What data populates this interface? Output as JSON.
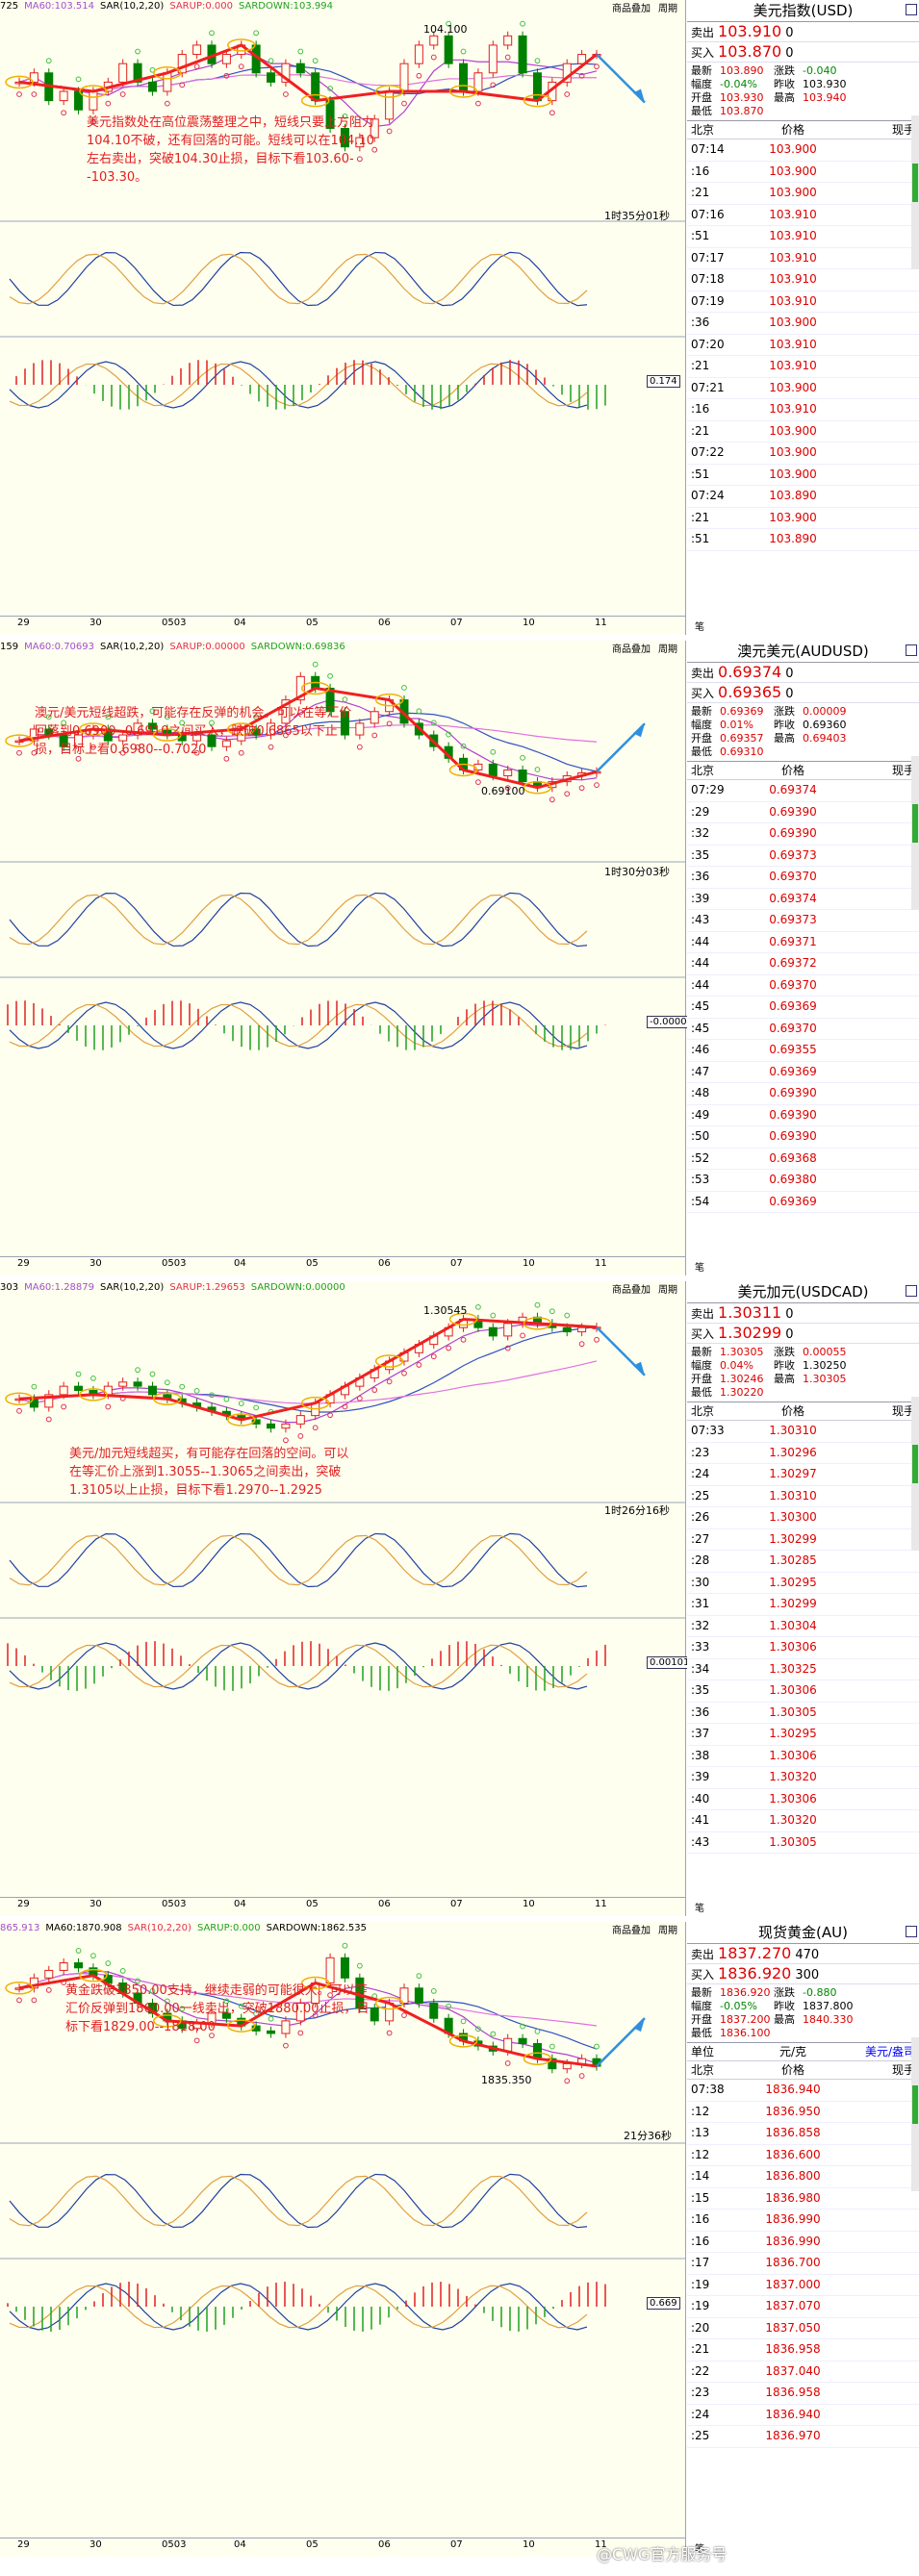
{
  "chart_data": [
    {
      "type": "candlestick",
      "symbol_cn": "美元指数(USD)",
      "indicators": [
        "MA60:103.514",
        "SAR(10,2,20)",
        "SARUP:0.000",
        "SARDOWN:103.994"
      ],
      "header_left": "725",
      "peak_label": "104.100",
      "x_ticks": [
        "29",
        "30",
        "0503",
        "04",
        "05",
        "06",
        "07",
        "10",
        "11"
      ],
      "timer": "1时35分01秒",
      "macd_value": "0.174",
      "close": [
        103.6,
        103.7,
        103.4,
        103.5,
        103.3,
        103.5,
        103.6,
        103.8,
        103.6,
        103.5,
        103.7,
        103.9,
        104.0,
        103.8,
        103.9,
        104.0,
        103.7,
        103.6,
        103.8,
        103.7,
        103.4,
        103.1,
        102.9,
        103.0,
        103.2,
        103.5,
        103.8,
        104.0,
        104.1,
        103.8,
        103.5,
        103.7,
        104.0,
        104.1,
        103.7,
        103.4,
        103.6,
        103.8,
        103.9,
        103.9
      ],
      "annotation": "美元指数处在高位震荡整理之中，短线只要上方阻力104.10不破，还有回落的可能。短线可以在104.10左右卖出，突破104.30止损，目标下看103.60--103.30。"
    },
    {
      "type": "candlestick",
      "symbol_cn": "澳元美元(AUDUSD)",
      "indicators": [
        "MA60:0.70693",
        "SAR(10,2,20)",
        "SARUP:0.00000",
        "SARDOWN:0.69836"
      ],
      "header_left": "159",
      "low_label": "0.69100",
      "x_ticks": [
        "29",
        "30",
        "0503",
        "04",
        "05",
        "06",
        "07",
        "10",
        "11"
      ],
      "timer": "1时30分03秒",
      "macd_value": "-0.00002",
      "close": [
        0.699,
        0.701,
        0.7,
        0.698,
        0.7,
        0.701,
        0.699,
        0.7,
        0.702,
        0.701,
        0.7,
        0.699,
        0.7,
        0.698,
        0.699,
        0.701,
        0.7,
        0.702,
        0.706,
        0.71,
        0.708,
        0.704,
        0.7,
        0.702,
        0.704,
        0.706,
        0.702,
        0.7,
        0.698,
        0.696,
        0.694,
        0.695,
        0.693,
        0.694,
        0.692,
        0.691,
        0.692,
        0.693,
        0.6935,
        0.6937
      ],
      "annotation": "澳元/美元短线超跌，可能存在反弹的机会。可以在等汇价回落到0.6900--0.6910之间买入，跌破0.6865以下止损，目标上看0.6980--0.7020"
    },
    {
      "type": "candlestick",
      "symbol_cn": "美元加元(USDCAD)",
      "indicators": [
        "MA60:1.28879",
        "SAR(10,2,20)",
        "SARUP:1.29653",
        "SARDOWN:0.00000"
      ],
      "header_left": "303",
      "peak_label": "1.30545",
      "x_ticks": [
        "29",
        "30",
        "0503",
        "04",
        "05",
        "06",
        "07",
        "10",
        "11"
      ],
      "timer": "1时26分16秒",
      "macd_value": "0.00101",
      "close": [
        1.286,
        1.284,
        1.287,
        1.289,
        1.288,
        1.287,
        1.289,
        1.29,
        1.289,
        1.287,
        1.286,
        1.285,
        1.284,
        1.283,
        1.282,
        1.281,
        1.28,
        1.279,
        1.28,
        1.282,
        1.285,
        1.287,
        1.289,
        1.291,
        1.293,
        1.295,
        1.297,
        1.299,
        1.301,
        1.303,
        1.305,
        1.303,
        1.301,
        1.304,
        1.3055,
        1.304,
        1.303,
        1.302,
        1.303,
        1.3031
      ],
      "annotation": "美元/加元短线超买，有可能存在回落的空间。可以在等汇价上涨到1.3055--1.3065之间卖出，突破1.3105以上止损，目标下看1.2970--1.2925"
    },
    {
      "type": "candlestick",
      "symbol_cn": "现货黄金(AU)",
      "indicators": [
        "865.913",
        "MA60:1870.908",
        "SAR(10,2,20)",
        "SARUP:0.000",
        "SARDOWN:1862.535"
      ],
      "low_label": "1835.350",
      "x_ticks": [
        "29",
        "30",
        "0503",
        "04",
        "05",
        "06",
        "07",
        "10",
        "11"
      ],
      "timer": "21分36秒",
      "macd_value": "0.669",
      "close": [
        1868,
        1872,
        1875,
        1878,
        1876,
        1873,
        1870,
        1866,
        1862,
        1858,
        1855,
        1852,
        1854,
        1858,
        1856,
        1853,
        1851,
        1850,
        1855,
        1862,
        1870,
        1880,
        1872,
        1860,
        1855,
        1862,
        1868,
        1862,
        1856,
        1850,
        1847,
        1845,
        1843,
        1848,
        1846,
        1840,
        1836,
        1838,
        1840,
        1837
      ],
      "annotation": "黄金跌破1850.00支持，继续走弱的可能很大。可以等汇价反弹到1860.00一线卖出，突破1880.00止损，目标下看1829.00--1818.00"
    }
  ],
  "common": {
    "btn_add": "商品叠加",
    "btn_period": "周期",
    "bottom_button": "笔"
  },
  "quotes": [
    {
      "title": "美元指数(USD)",
      "sell_label": "卖出",
      "sell": "103.910",
      "sell_vol": "0",
      "buy_label": "买入",
      "buy": "103.870",
      "buy_vol": "0",
      "stats": [
        [
          "最新",
          "103.890",
          "涨跌",
          "-0.040"
        ],
        [
          "幅度",
          "-0.04%",
          "昨收",
          "103.930"
        ],
        [
          "开盘",
          "103.930",
          "最高",
          "103.940"
        ],
        [
          "最低",
          "103.870",
          "",
          ""
        ]
      ],
      "hdr": [
        "北京",
        "价格",
        "现手"
      ],
      "ticks": [
        [
          "07:14",
          "103.900"
        ],
        [
          ":16",
          "103.900"
        ],
        [
          ":21",
          "103.900"
        ],
        [
          "07:16",
          "103.910"
        ],
        [
          ":51",
          "103.910"
        ],
        [
          "07:17",
          "103.910"
        ],
        [
          "07:18",
          "103.910"
        ],
        [
          "07:19",
          "103.910"
        ],
        [
          ":36",
          "103.900"
        ],
        [
          "07:20",
          "103.910"
        ],
        [
          ":21",
          "103.910"
        ],
        [
          "07:21",
          "103.900"
        ],
        [
          ":16",
          "103.910"
        ],
        [
          ":21",
          "103.900"
        ],
        [
          "07:22",
          "103.900"
        ],
        [
          ":51",
          "103.900"
        ],
        [
          "07:24",
          "103.890"
        ],
        [
          ":21",
          "103.900"
        ],
        [
          ":51",
          "103.890"
        ]
      ]
    },
    {
      "title": "澳元美元(AUDUSD)",
      "sell_label": "卖出",
      "sell": "0.69374",
      "sell_vol": "0",
      "buy_label": "买入",
      "buy": "0.69365",
      "buy_vol": "0",
      "stats": [
        [
          "最新",
          "0.69369",
          "涨跌",
          "0.00009"
        ],
        [
          "幅度",
          "0.01%",
          "昨收",
          "0.69360"
        ],
        [
          "开盘",
          "0.69357",
          "最高",
          "0.69403"
        ],
        [
          "最低",
          "0.69310",
          "",
          ""
        ]
      ],
      "hdr": [
        "北京",
        "价格",
        "现手"
      ],
      "ticks": [
        [
          "07:29",
          "0.69374"
        ],
        [
          ":29",
          "0.69390"
        ],
        [
          ":32",
          "0.69390"
        ],
        [
          ":35",
          "0.69373"
        ],
        [
          ":36",
          "0.69370"
        ],
        [
          ":39",
          "0.69374"
        ],
        [
          ":43",
          "0.69373"
        ],
        [
          ":44",
          "0.69371"
        ],
        [
          ":44",
          "0.69372"
        ],
        [
          ":44",
          "0.69370"
        ],
        [
          ":45",
          "0.69369"
        ],
        [
          ":45",
          "0.69370"
        ],
        [
          ":46",
          "0.69355"
        ],
        [
          ":47",
          "0.69369"
        ],
        [
          ":48",
          "0.69390"
        ],
        [
          ":49",
          "0.69390"
        ],
        [
          ":50",
          "0.69390"
        ],
        [
          ":52",
          "0.69368"
        ],
        [
          ":53",
          "0.69380"
        ],
        [
          ":54",
          "0.69369"
        ]
      ]
    },
    {
      "title": "美元加元(USDCAD)",
      "sell_label": "卖出",
      "sell": "1.30311",
      "sell_vol": "0",
      "buy_label": "买入",
      "buy": "1.30299",
      "buy_vol": "0",
      "stats": [
        [
          "最新",
          "1.30305",
          "涨跌",
          "0.00055"
        ],
        [
          "幅度",
          "0.04%",
          "昨收",
          "1.30250"
        ],
        [
          "开盘",
          "1.30246",
          "最高",
          "1.30305"
        ],
        [
          "最低",
          "1.30220",
          "",
          ""
        ]
      ],
      "hdr": [
        "北京",
        "价格",
        "现手"
      ],
      "ticks": [
        [
          "07:33",
          "1.30310"
        ],
        [
          ":23",
          "1.30296"
        ],
        [
          ":24",
          "1.30297"
        ],
        [
          ":25",
          "1.30310"
        ],
        [
          ":26",
          "1.30300"
        ],
        [
          ":27",
          "1.30299"
        ],
        [
          ":28",
          "1.30285"
        ],
        [
          ":30",
          "1.30295"
        ],
        [
          ":31",
          "1.30299"
        ],
        [
          ":32",
          "1.30304"
        ],
        [
          ":33",
          "1.30306"
        ],
        [
          ":34",
          "1.30325"
        ],
        [
          ":35",
          "1.30306"
        ],
        [
          ":36",
          "1.30305"
        ],
        [
          ":37",
          "1.30295"
        ],
        [
          ":38",
          "1.30306"
        ],
        [
          ":39",
          "1.30320"
        ],
        [
          ":40",
          "1.30306"
        ],
        [
          ":41",
          "1.30320"
        ],
        [
          ":43",
          "1.30305"
        ]
      ]
    },
    {
      "title": "现货黄金(AU)",
      "sell_label": "卖出",
      "sell": "1837.270",
      "sell_vol": "470",
      "buy_label": "买入",
      "buy": "1836.920",
      "buy_vol": "300",
      "stats": [
        [
          "最新",
          "1836.920",
          "涨跌",
          "-0.880"
        ],
        [
          "幅度",
          "-0.05%",
          "昨收",
          "1837.800"
        ],
        [
          "开盘",
          "1837.200",
          "最高",
          "1840.330"
        ],
        [
          "最低",
          "1836.100",
          "",
          ""
        ]
      ],
      "hdr": [
        "单位",
        "元/克",
        "美元/盎司"
      ],
      "hdr2": [
        "北京",
        "价格",
        "现手"
      ],
      "ticks": [
        [
          "07:38",
          "1836.940"
        ],
        [
          ":12",
          "1836.950"
        ],
        [
          ":13",
          "1836.858"
        ],
        [
          ":12",
          "1836.600"
        ],
        [
          ":14",
          "1836.800"
        ],
        [
          ":15",
          "1836.980"
        ],
        [
          ":16",
          "1836.990"
        ],
        [
          ":16",
          "1836.990"
        ],
        [
          ":17",
          "1836.700"
        ],
        [
          ":19",
          "1837.000"
        ],
        [
          ":19",
          "1837.070"
        ],
        [
          ":20",
          "1837.050"
        ],
        [
          ":21",
          "1836.958"
        ],
        [
          ":22",
          "1837.040"
        ],
        [
          ":23",
          "1836.958"
        ],
        [
          ":24",
          "1836.940"
        ],
        [
          ":25",
          "1836.970"
        ]
      ]
    }
  ],
  "watermark": "@CWG官方服务号",
  "colors": {
    "up": "#e02020",
    "down": "#008000",
    "bg": "#fffff0",
    "sar_up": "#e03050",
    "sar_down": "#40c040",
    "arrow": "#3090e0"
  }
}
